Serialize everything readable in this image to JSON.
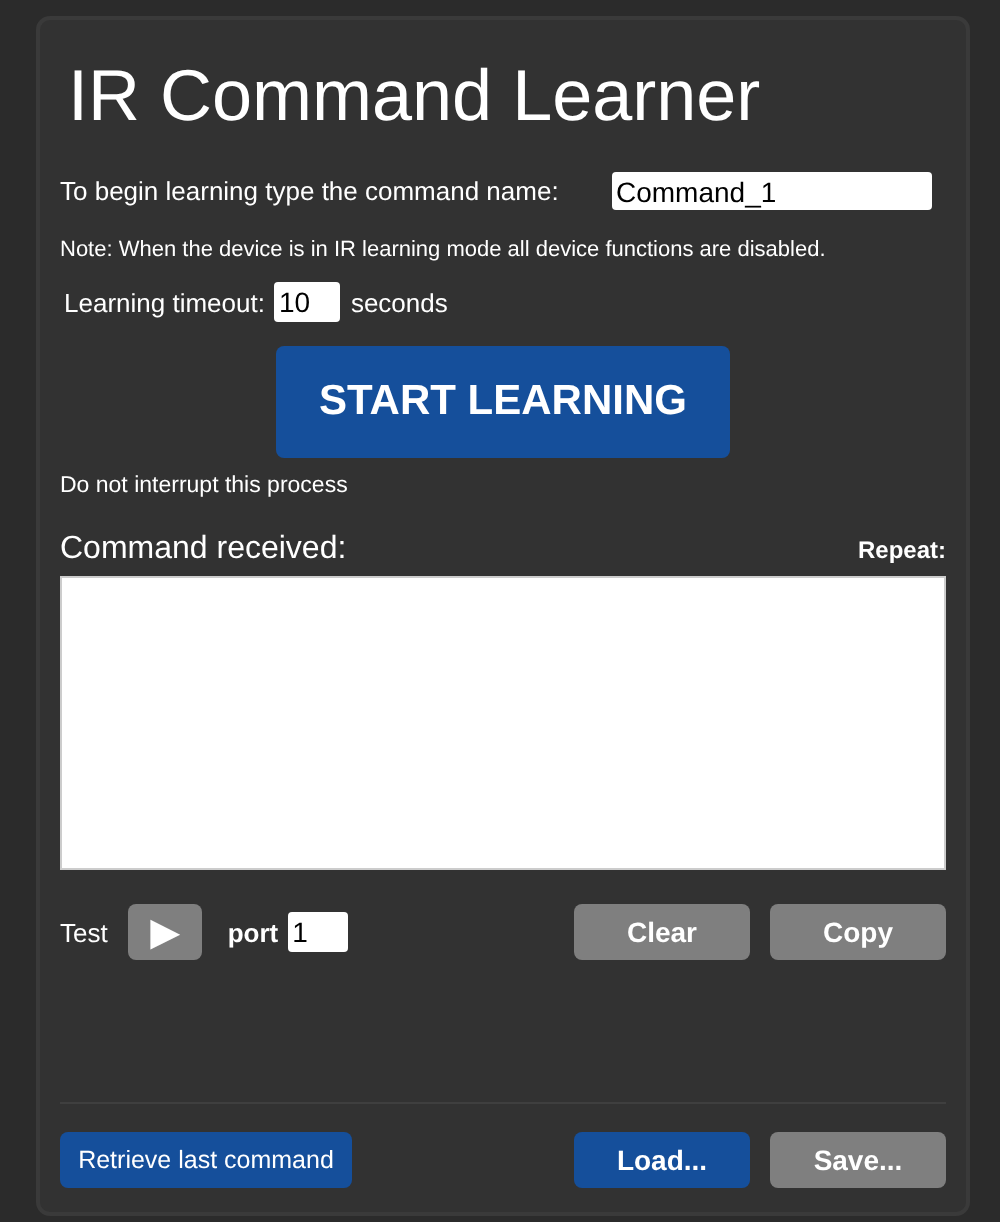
{
  "title": "IR Command Learner",
  "name_prompt": {
    "label": "To begin learning type the command name:",
    "value": "Command_1"
  },
  "note": "Note: When the device is in IR learning mode all device functions are disabled.",
  "timeout": {
    "label": "Learning timeout:",
    "value": "10",
    "unit": "seconds"
  },
  "start_button": {
    "label": "START LEARNING",
    "disabled": false
  },
  "warning": "Do not interrupt this process",
  "command": {
    "label": "Command received:",
    "repeat_label": "Repeat:"
  },
  "test": {
    "label": "Test",
    "play": {
      "label": "▶",
      "disabled": true
    },
    "port_label": "port",
    "port_value": "1"
  },
  "actions": [
    {
      "label": "Clear",
      "disabled": true
    },
    {
      "label": "Copy",
      "disabled": true
    }
  ],
  "footer": {
    "retrieve": {
      "label": "Retrieve last command",
      "disabled": false
    },
    "buttons": [
      {
        "label": "Load...",
        "disabled": false
      },
      {
        "label": "Save...",
        "disabled": true
      }
    ]
  }
}
